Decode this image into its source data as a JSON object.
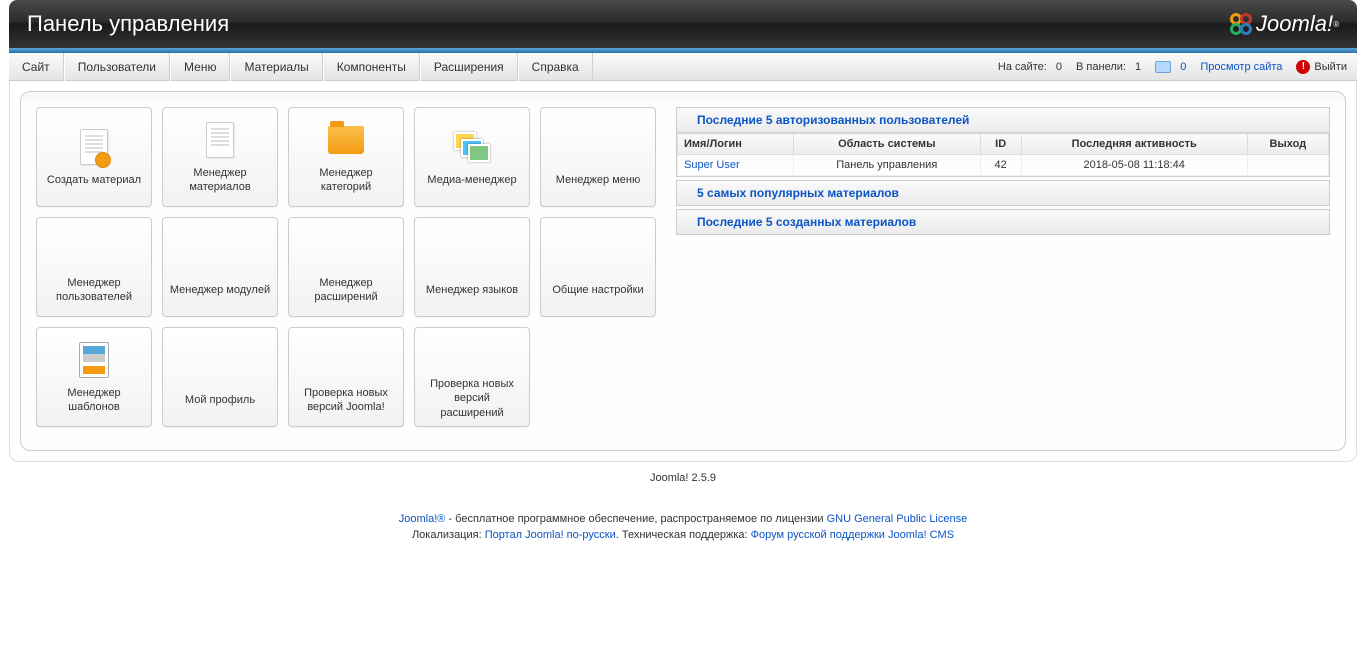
{
  "header": {
    "title": "Панель управления",
    "brand": "Joomla!"
  },
  "menu": {
    "items": [
      "Сайт",
      "Пользователи",
      "Меню",
      "Материалы",
      "Компоненты",
      "Расширения",
      "Справка"
    ]
  },
  "status": {
    "visitors_label": "На сайте:",
    "visitors_count": "0",
    "admin_label": "В панели:",
    "admin_count": "1",
    "messages_count": "0",
    "view_site": "Просмотр сайта",
    "logout": "Выйти"
  },
  "quickicons": [
    {
      "label": "Создать материал",
      "icon": "doc-add",
      "name": "add-article"
    },
    {
      "label": "Менеджер материалов",
      "icon": "doc",
      "name": "article-manager"
    },
    {
      "label": "Менеджер категорий",
      "icon": "folder",
      "name": "category-manager"
    },
    {
      "label": "Медиа-менеджер",
      "icon": "media",
      "name": "media-manager"
    },
    {
      "label": "Менеджер меню",
      "icon": "none",
      "name": "menu-manager"
    },
    {
      "label": "Менеджер пользователей",
      "icon": "none",
      "name": "user-manager"
    },
    {
      "label": "Менеджер модулей",
      "icon": "none",
      "name": "module-manager"
    },
    {
      "label": "Менеджер расширений",
      "icon": "none",
      "name": "extension-manager"
    },
    {
      "label": "Менеджер языков",
      "icon": "none",
      "name": "language-manager"
    },
    {
      "label": "Общие настройки",
      "icon": "none",
      "name": "global-config"
    },
    {
      "label": "Менеджер шаблонов",
      "icon": "template",
      "name": "template-manager"
    },
    {
      "label": "Мой профиль",
      "icon": "none",
      "name": "my-profile"
    },
    {
      "label": "Проверка новых версий Joomla!",
      "icon": "none",
      "name": "joomla-update"
    },
    {
      "label": "Проверка новых версий расширений",
      "icon": "none",
      "name": "extensions-update"
    }
  ],
  "panels": {
    "logged": {
      "title": "Последние 5 авторизованных пользователей",
      "columns": [
        "Имя/Логин",
        "Область системы",
        "ID",
        "Последняя активность",
        "Выход"
      ],
      "rows": [
        {
          "name": "Super User",
          "area": "Панель управления",
          "id": "42",
          "activity": "2018-05-08 11:18:44",
          "logout": ""
        }
      ]
    },
    "popular": {
      "title": "5 самых популярных материалов"
    },
    "recent": {
      "title": "Последние 5 созданных материалов"
    }
  },
  "footer": {
    "version": "Joomla! 2.5.9",
    "line1_a": "Joomla!®",
    "line1_b": " - бесплатное программное обеспечение, распространяемое по лицензии ",
    "line1_c": "GNU General Public License",
    "line2_a": "Локализация: ",
    "line2_b": "Портал Joomla! по-русски",
    "line2_c": ". Техническая поддержка: ",
    "line2_d": "Форум русской поддержки Joomla! CMS"
  }
}
